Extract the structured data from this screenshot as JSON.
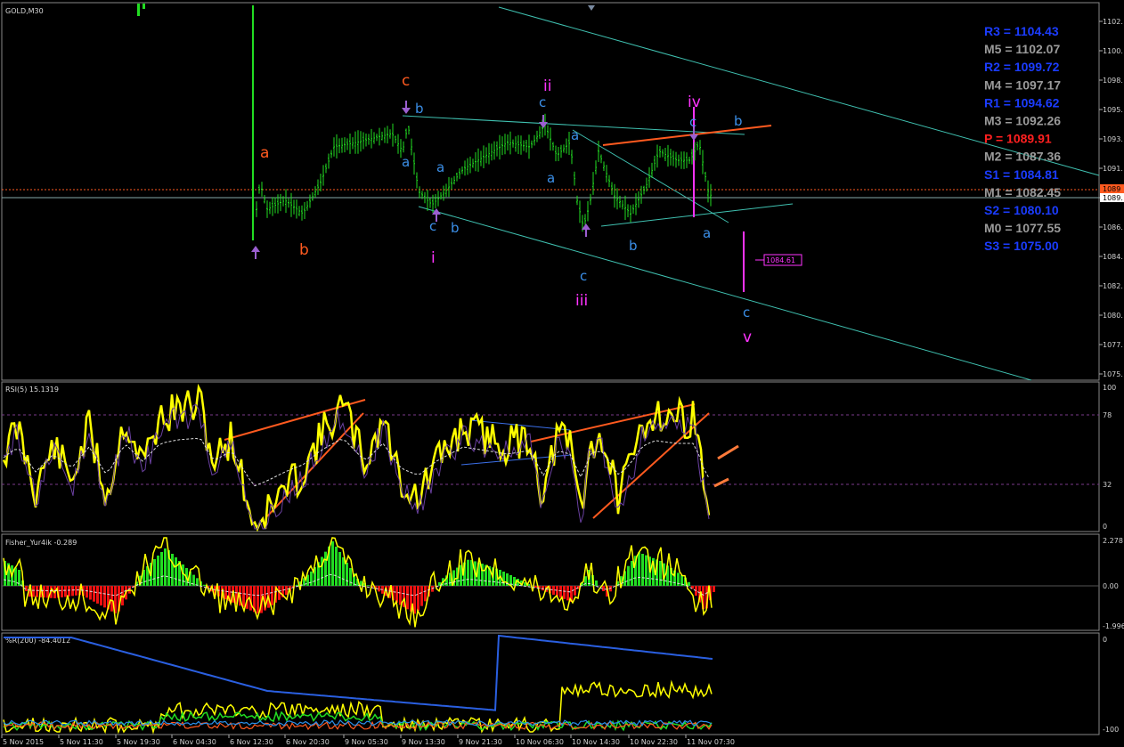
{
  "colors": {
    "background": "#000000",
    "candle": "#22dd22",
    "channel": "#3fc0b0",
    "wave_orange": "#ff5a1f",
    "wave_blue": "#3b8fe8",
    "wave_magenta": "#ff33ff",
    "rsi": "#ffff00",
    "fisher_up": "#22dd22",
    "fisher_down": "#ee1111",
    "pivot_blue": "#1b3cff",
    "pivot_gray": "#9a9a9a",
    "pivot_red": "#ff2020"
  },
  "main": {
    "title": "GOLD,M30",
    "price_axis": [
      "1102.",
      "1100.",
      "1098.",
      "1095.",
      "1093.",
      "1091.",
      "1089.",
      "1086.",
      "1084.",
      "1082.",
      "1080.",
      "1077.",
      "1075."
    ],
    "price_tag_1": "1089",
    "price_tag_2": "1089.",
    "target_label": "1084.61",
    "pivots": [
      {
        "text": "R3 = 1104.43",
        "color": "#1b3cff"
      },
      {
        "text": "M5 = 1102.07",
        "color": "#9a9a9a"
      },
      {
        "text": "R2 = 1099.72",
        "color": "#1b3cff"
      },
      {
        "text": "M4 = 1097.17",
        "color": "#9a9a9a"
      },
      {
        "text": "R1 = 1094.62",
        "color": "#1b3cff"
      },
      {
        "text": "M3 = 1092.26",
        "color": "#9a9a9a"
      },
      {
        "text": "P   = 1089.91",
        "color": "#ff2020"
      },
      {
        "text": "M2 = 1087.36",
        "color": "#9a9a9a"
      },
      {
        "text": "S1 = 1084.81",
        "color": "#1b3cff"
      },
      {
        "text": "M1 = 1082.45",
        "color": "#9a9a9a"
      },
      {
        "text": "S2 = 1080.10",
        "color": "#1b3cff"
      },
      {
        "text": "M0 = 1077.55",
        "color": "#9a9a9a"
      },
      {
        "text": "S3 = 1075.00",
        "color": "#1b3cff"
      }
    ],
    "wave_labels": [
      {
        "text": "c",
        "color": "#ff5a1f"
      },
      {
        "text": "a",
        "color": "#ff5a1f"
      },
      {
        "text": "b",
        "color": "#ff5a1f"
      },
      {
        "text": "b",
        "color": "#3b8fe8"
      },
      {
        "text": "a",
        "color": "#3b8fe8"
      },
      {
        "text": "a",
        "color": "#3b8fe8"
      },
      {
        "text": "c",
        "color": "#3b8fe8"
      },
      {
        "text": "b",
        "color": "#3b8fe8"
      },
      {
        "text": "i",
        "color": "#ff33ff"
      },
      {
        "text": "ii",
        "color": "#ff33ff"
      },
      {
        "text": "c",
        "color": "#3b8fe8"
      },
      {
        "text": "a",
        "color": "#3b8fe8"
      },
      {
        "text": "a",
        "color": "#3b8fe8"
      },
      {
        "text": "b",
        "color": "#3b8fe8"
      },
      {
        "text": "c",
        "color": "#3b8fe8"
      },
      {
        "text": "iii",
        "color": "#ff33ff"
      },
      {
        "text": "iv",
        "color": "#ff33ff"
      },
      {
        "text": "c",
        "color": "#3b8fe8"
      },
      {
        "text": "b",
        "color": "#3b8fe8"
      },
      {
        "text": "a",
        "color": "#3b8fe8"
      },
      {
        "text": "c",
        "color": "#3b8fe8"
      },
      {
        "text": "v",
        "color": "#ff33ff"
      }
    ]
  },
  "rsi": {
    "title": "RSI(5) 15.1319",
    "axis": [
      "100",
      "78",
      "32",
      "0"
    ]
  },
  "fisher": {
    "title": "Fisher_Yur4ik -0.289",
    "axis": [
      "2.278",
      "0.00",
      "-1.996"
    ]
  },
  "wpr": {
    "title": "%R(200) -84.4012",
    "axis": [
      "0",
      "-100"
    ]
  },
  "time_axis": [
    "5 Nov 2015",
    "5 Nov 11:30",
    "5 Nov 19:30",
    "6 Nov 04:30",
    "6 Nov 12:30",
    "6 Nov 20:30",
    "9 Nov 05:30",
    "9 Nov 13:30",
    "9 Nov 21:30",
    "10 Nov 06:30",
    "10 Nov 14:30",
    "10 Nov 22:30",
    "11 Nov 07:30"
  ],
  "chart_data": {
    "type": "line",
    "symbol": "GOLD",
    "timeframe": "M30",
    "indicators": [
      {
        "name": "RSI(5)",
        "last": 15.1319,
        "levels": [
          78,
          32
        ]
      },
      {
        "name": "Fisher_Yur4ik",
        "last": -0.289,
        "range": [
          -1.996,
          2.278
        ]
      },
      {
        "name": "%R(200)",
        "last": -84.4012,
        "range": [
          -100,
          0
        ]
      }
    ],
    "pivots": {
      "R3": 1104.43,
      "M5": 1102.07,
      "R2": 1099.72,
      "M4": 1097.17,
      "R1": 1094.62,
      "M3": 1092.26,
      "P": 1089.91,
      "M2": 1087.36,
      "S1": 1084.81,
      "M1": 1082.45,
      "S2": 1080.1,
      "M0": 1077.55,
      "S3": 1075.0
    },
    "price_range": [
      1074,
      1103.5
    ],
    "target": 1084.61
  }
}
